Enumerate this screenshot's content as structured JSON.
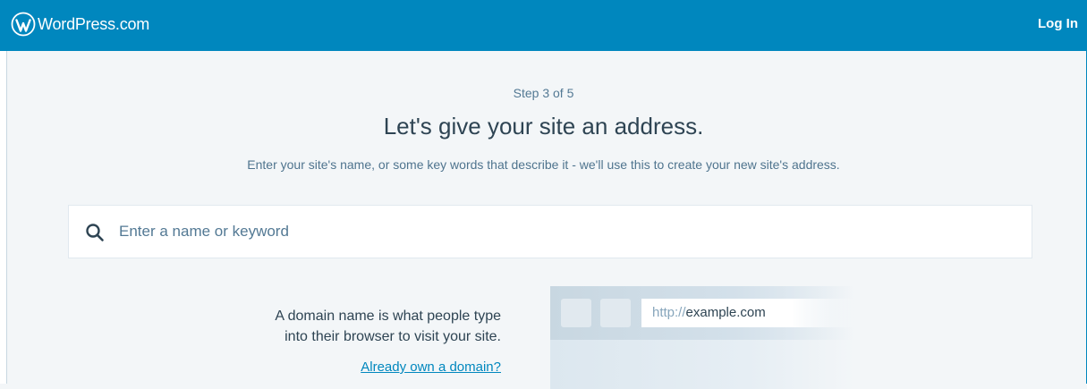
{
  "masterbar": {
    "brand": "WordPress.com",
    "login_label": "Log In"
  },
  "main": {
    "step": "Step 3 of 5",
    "headline": "Let's give your site an address.",
    "subhead": "Enter your site's name, or some key words that describe it - we'll use this to create your new site's address."
  },
  "search": {
    "placeholder": "Enter a name or keyword",
    "value": ""
  },
  "info": {
    "line1": "A domain name is what people type",
    "line2": "into their browser to visit your site.",
    "link": "Already own a domain?"
  },
  "browser": {
    "protocol": "http://",
    "domain": "example.com"
  },
  "icons": {
    "logo": "wordpress-logo-icon",
    "search": "search-icon"
  },
  "colors": {
    "brand": "#0087be",
    "background": "#f3f6f8",
    "text": "#2e4453",
    "muted": "#537994"
  }
}
